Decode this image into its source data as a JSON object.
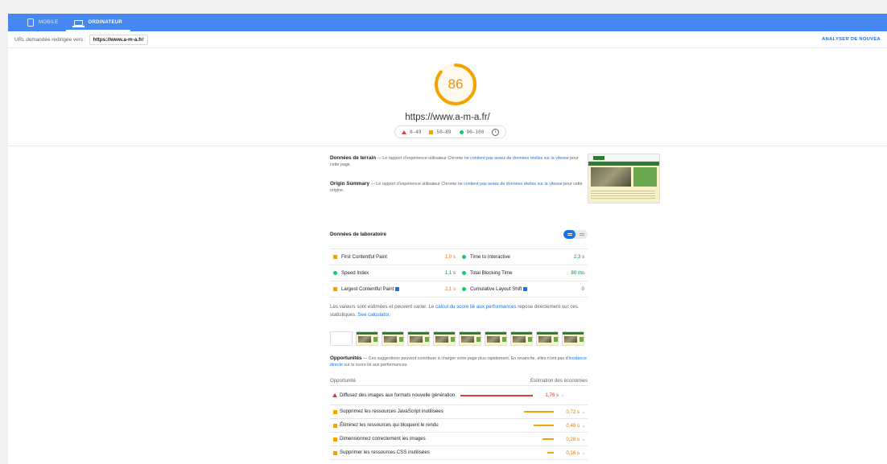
{
  "tabs": [
    {
      "label": "MOBILE",
      "icon": "phone-icon",
      "active": false
    },
    {
      "label": "ORDINATEUR",
      "icon": "desktop-icon",
      "active": true
    }
  ],
  "urlbar": {
    "label": "URL demandée redirigée vers :",
    "url": "https://www.a-m-a.fr/",
    "analyze": "ANALYSER DE NOUVEA"
  },
  "score": {
    "value": "86",
    "fraction": 0.86,
    "url": "https://www.a-m-a.fr/",
    "legend": [
      {
        "range": "0–49",
        "shape": "triangle",
        "color": "#e53935"
      },
      {
        "range": "50–89",
        "shape": "square",
        "color": "#f4a300"
      },
      {
        "range": "90–100",
        "shape": "circle",
        "color": "#0cce6b"
      }
    ],
    "info_icon": "info-icon"
  },
  "field_data": {
    "title": "Données de terrain",
    "dash": "—",
    "text_before": "Le rapport d'expérience utilisateur Chrome",
    "link": "ne contient pas assez de données réelles sur la vitesse",
    "text_after": "pour cette page."
  },
  "origin_summary": {
    "title": "Origin Summary",
    "dash": "—",
    "text_before": "Le rapport d'expérience utilisateur Chrome",
    "link": "ne contient pas assez de données réelles sur la vitesse",
    "text_after": "pour cette origine."
  },
  "lab": {
    "title": "Données de laboratoire",
    "rows": [
      [
        {
          "name": "First Contentful Paint",
          "value": "1,0 s",
          "status": "average",
          "flag": false
        },
        {
          "name": "Time to Interactive",
          "value": "2,3 s",
          "status": "good",
          "flag": false
        }
      ],
      [
        {
          "name": "Speed Index",
          "value": "1,1 s",
          "status": "good",
          "flag": false
        },
        {
          "name": "Total Blocking Time",
          "value": "80 ms",
          "status": "good",
          "flag": false
        }
      ],
      [
        {
          "name": "Largest Contentful Paint",
          "value": "2,1 s",
          "status": "average",
          "flag": true
        },
        {
          "name": "Cumulative Layout Shift",
          "value": "0",
          "status": "good",
          "flag": true
        }
      ]
    ]
  },
  "note": {
    "text1": "Les valeurs sont estimées et peuvent varier. Le",
    "link1": "calcul du score lié aux performances",
    "text2": "repose directement sur ces statistiques.",
    "link2": "See calculator."
  },
  "filmstrip": {
    "frames": [
      false,
      true,
      true,
      true,
      true,
      true,
      true,
      true,
      true,
      true
    ]
  },
  "opportunities": {
    "title": "Opportunités",
    "dash": "—",
    "text1": "Ces suggestions peuvent contribuer à charger votre page plus rapidement. En revanche, elles n'ont pas d'",
    "link": "incidence directe",
    "text2": "sur le score lié aux performances.",
    "col_left": "Opportunité",
    "col_right": "Estimation des économies",
    "items": [
      {
        "name": "Diffusez des images aux formats nouvelle génération",
        "savings": "1,76 s",
        "seconds": 1.76,
        "status": "bad"
      },
      {
        "name": "Supprimez les ressources JavaScript inutilisées",
        "savings": "0,72 s",
        "seconds": 0.72,
        "status": "average"
      },
      {
        "name": "Éliminez les ressources qui bloquent le rendu",
        "savings": "0,49 s",
        "seconds": 0.49,
        "status": "average"
      },
      {
        "name": "Dimensionnez correctement les images",
        "savings": "0,28 s",
        "seconds": 0.28,
        "status": "average"
      },
      {
        "name": "Supprimer les ressources CSS inutilisées",
        "savings": "0,16 s",
        "seconds": 0.16,
        "status": "average"
      }
    ]
  },
  "colors": {
    "accent": "#4688f1",
    "link": "#1a73e8",
    "average": "#f4a300",
    "good": "#0cce6b",
    "bad": "#e53935"
  }
}
